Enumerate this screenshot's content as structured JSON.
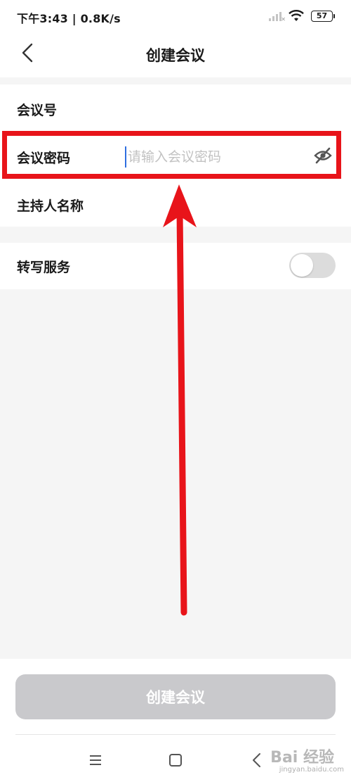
{
  "status_bar": {
    "time_speed": "下午3:43 | 0.8K/s",
    "battery": "57"
  },
  "nav": {
    "title": "创建会议"
  },
  "form": {
    "meeting_id_label": "会议号",
    "password_label": "会议密码",
    "password_placeholder": "请输入会议密码",
    "password_value": "",
    "host_name_label": "主持人名称",
    "transcription_label": "转写服务",
    "transcription_enabled": false
  },
  "actions": {
    "create_button": "创建会议"
  },
  "watermark": {
    "logo": "Bai 经验",
    "url": "jingyan.baidu.com"
  },
  "colors": {
    "annotation_red": "#e8141a",
    "disabled_button": "#c9c9cc",
    "toggle_off": "#dcdcdc",
    "cursor_blue": "#2f6fe0"
  },
  "icons": {
    "back": "back-chevron-icon",
    "eye": "eye-slash-icon",
    "wifi": "wifi-icon",
    "signal": "signal-icon",
    "battery": "battery-icon",
    "menu": "menu-icon",
    "home": "home-icon",
    "system_back": "system-back-icon"
  }
}
